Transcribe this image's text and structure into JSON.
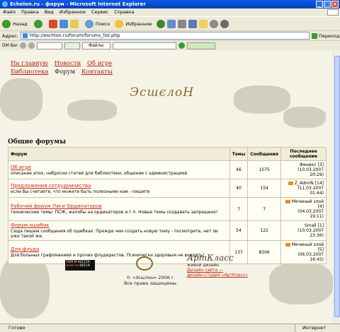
{
  "window": {
    "title": "Eсhelon.ru - форум - Microsoft Internet Explorer",
    "buttons": [
      "_",
      "□",
      "×"
    ]
  },
  "menu": [
    "Файл",
    "Правка",
    "Вид",
    "Избранное",
    "Сервис",
    "Справка"
  ],
  "toolbar": {
    "back": "Назад",
    "search": "Поиск",
    "favorites": "Избранное"
  },
  "address": {
    "label": "Адрес:",
    "url": "http://eschlon.ru/forum/forums_list.php",
    "go": "Переход"
  },
  "linksbar": {
    "dm": "DM Bar",
    "files": "Файлы"
  },
  "nav": {
    "home": "На главную",
    "news": "Новости",
    "about": "Об игре",
    "library": "Библиотека",
    "forum": "Форум",
    "contacts": "Контакты"
  },
  "site_logo": "ЭсшєлоН",
  "section_title": "Общие форумы",
  "table": {
    "headers": {
      "forum": "Форум",
      "topics": "Темы",
      "posts": "Сообщения",
      "last": "Последнее сообщение"
    },
    "rows": [
      {
        "title": "Об игре",
        "desc": "описание эпох, наброски статей для библиотеки, общение с администрацией",
        "topics": "46",
        "posts": "1075",
        "last_user": "Феникс [3]",
        "last_date": "(10.03.2007 20:29)",
        "mail": false
      },
      {
        "title": "Предложения сотрудничества",
        "desc": "если Вы считаете, что можете быть полезными нам - пишите",
        "topics": "40",
        "posts": "154",
        "last_user": "Z_AdmiN [14]",
        "last_date": "(11.03.2007 01:44)",
        "mail": true
      },
      {
        "title": "Рабочий форум Лиги Ординаторов",
        "desc": "технические темы: ПСЖ, жалобы на ординаторов и т.п. Новые темы создавать запрещено!",
        "topics": "7",
        "posts": "7",
        "last_user": "Меченый злой [4]",
        "last_date": "(04.03.2007 19:11)",
        "mail": true
      },
      {
        "title": "Форум ошибок",
        "desc": "Сюда пишем сообщения об ошибках. Прежде чем создать новую тему - посмотрите, нет ли уже такой же.",
        "topics": "54",
        "posts": "122",
        "last_user": "Small [1]",
        "last_date": "(10.03.2007 23:36)",
        "mail": false
      },
      {
        "title": "Для флуда",
        "desc": "Для больных графоманией и прочих флудерастов. Психически здоровым не входить!",
        "topics": "137",
        "posts": "8306",
        "last_user": "Меченый злой [5]",
        "last_date": "(06.03.2007 16:45)",
        "mail": true
      }
    ]
  },
  "footer": {
    "copyright": "© «Эсшлон» 2006 г.",
    "rights": "Все права защищены.",
    "counter_line1": "ТОРГИ",
    "counter_line2": "mail.ru",
    "counter_num1": "941159",
    "counter_num2": "68119",
    "art_brand": "АртКласс",
    "art_tag": "живой дизайн",
    "art_link1": "Дизайн сайта —",
    "art_link2": "дизайн-студия «АртКласс»"
  },
  "status": {
    "text": "Готово",
    "zone": "Интернет"
  }
}
